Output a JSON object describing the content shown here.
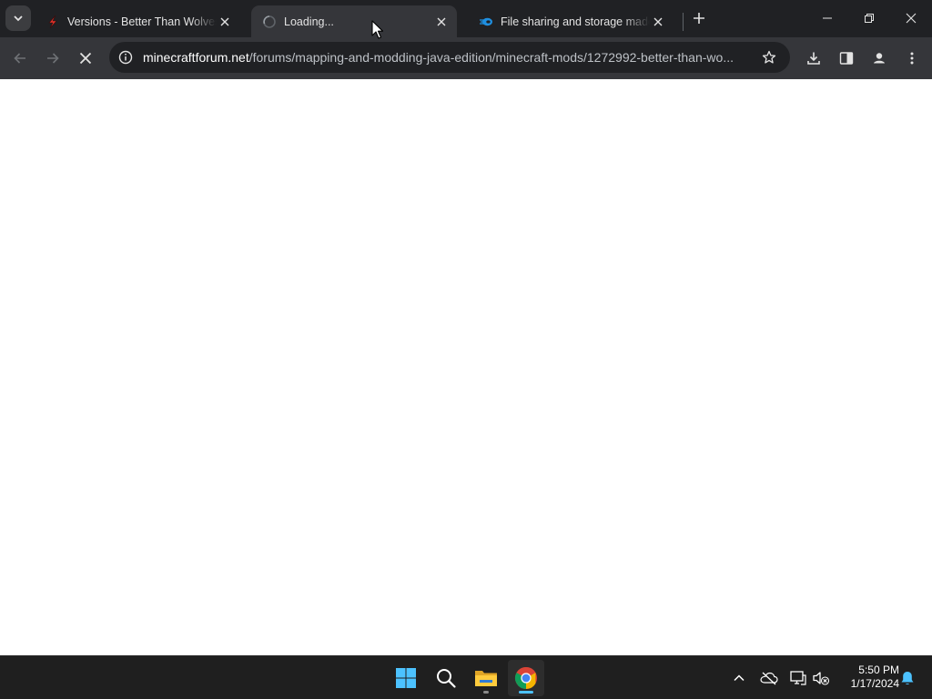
{
  "browser": {
    "tabs": [
      {
        "title": "Versions - Better Than Wolves Wiki",
        "favicon": "btw-lightning-icon",
        "active": false
      },
      {
        "title": "Loading...",
        "favicon": "loading-spinner-icon",
        "active": true
      },
      {
        "title": "File sharing and storage made simple",
        "favicon": "mediafire-icon",
        "active": false
      }
    ],
    "address_bar": {
      "host": "minecraftforum.net",
      "path": "/forums/mapping-and-modding-java-edition/minecraft-mods/1272992-better-than-wo..."
    }
  },
  "taskbar": {
    "apps": [
      "windows-start-icon",
      "search-icon",
      "file-explorer-icon",
      "chrome-icon"
    ],
    "time": "5:50 PM",
    "date": "1/17/2024"
  },
  "colors": {
    "tabstrip": "#202124",
    "toolbar": "#35363a",
    "omnibox": "#202124",
    "taskbar": "#1f1f1f",
    "accent_blue": "#4cc2ff"
  }
}
